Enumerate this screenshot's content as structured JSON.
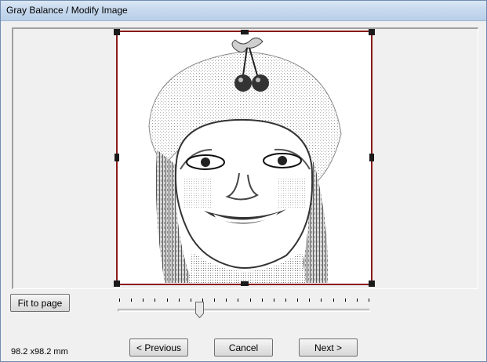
{
  "window": {
    "title": "Gray Balance / Modify Image"
  },
  "buttons": {
    "fit_to_page": "Fit to page",
    "previous": "< Previous",
    "cancel": "Cancel",
    "next": "Next >"
  },
  "slider": {
    "tick_count": 22,
    "position_fraction": 0.31
  },
  "image_size": "98.2 x98.2 mm",
  "colors": {
    "selection_border": "#8b1a1a",
    "title_bar": "#c7d9ee"
  }
}
